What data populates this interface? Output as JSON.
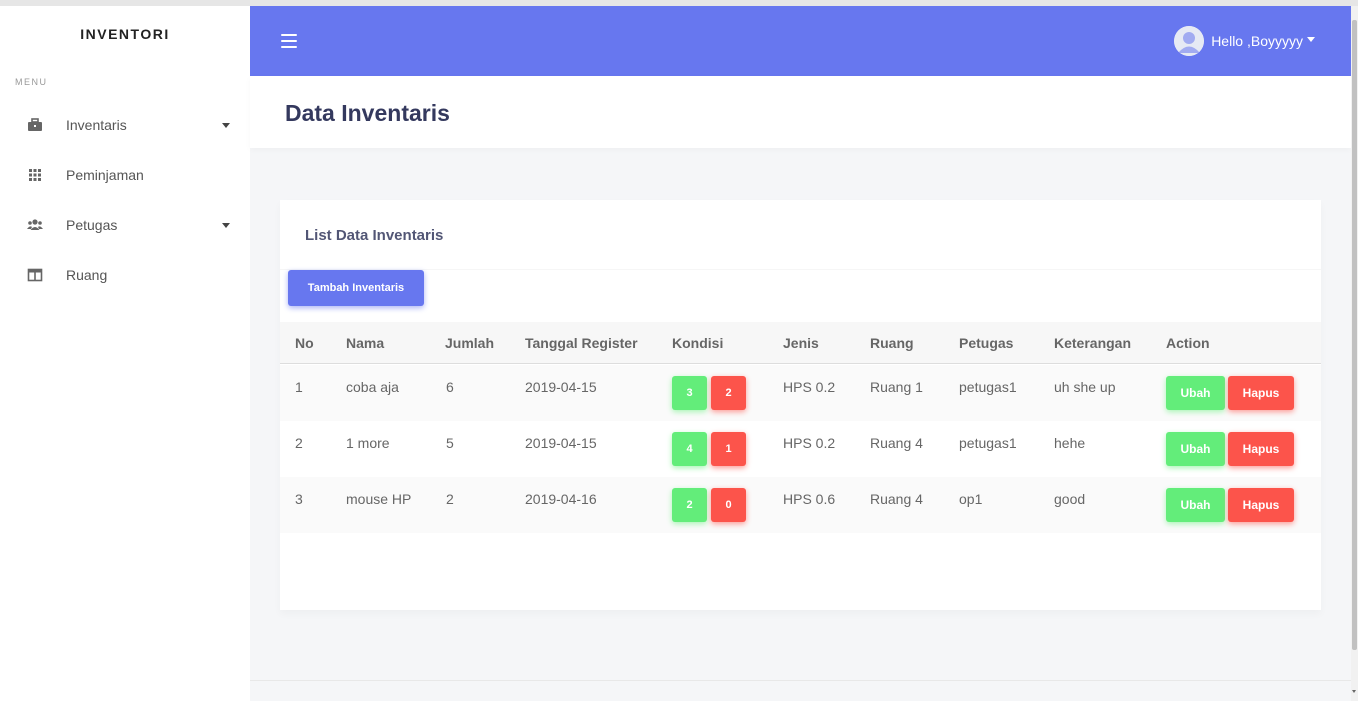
{
  "sidebar": {
    "brand": "INVENTORI",
    "menu_label": "MENU",
    "items": [
      {
        "label": "Inventaris",
        "icon": "briefcase-icon",
        "has_caret": true
      },
      {
        "label": "Peminjaman",
        "icon": "grid-icon",
        "has_caret": false
      },
      {
        "label": "Petugas",
        "icon": "users-icon",
        "has_caret": true
      },
      {
        "label": "Ruang",
        "icon": "columns-icon",
        "has_caret": false
      }
    ]
  },
  "topbar": {
    "menu_icon": "hamburger-icon",
    "user_greeting": "Hello ,Boyyyyy"
  },
  "page": {
    "title": "Data Inventaris"
  },
  "card": {
    "title": "List Data Inventaris",
    "add_button": "Tambah Inventaris",
    "columns": [
      "No",
      "Nama",
      "Jumlah",
      "Tanggal Register",
      "Kondisi",
      "Jenis",
      "Ruang",
      "Petugas",
      "Keterangan",
      "Action"
    ],
    "rows": [
      {
        "no": "1",
        "nama": "coba aja",
        "jumlah": "6",
        "tanggal": "2019-04-15",
        "kondisi_baik": "3",
        "kondisi_rusak": "2",
        "jenis": "HPS 0.2",
        "ruang": "Ruang 1",
        "petugas": "petugas1",
        "keterangan": "uh she up",
        "edit": "Ubah",
        "delete": "Hapus"
      },
      {
        "no": "2",
        "nama": "1 more",
        "jumlah": "5",
        "tanggal": "2019-04-15",
        "kondisi_baik": "4",
        "kondisi_rusak": "1",
        "jenis": "HPS 0.2",
        "ruang": "Ruang 4",
        "petugas": "petugas1",
        "keterangan": "hehe",
        "edit": "Ubah",
        "delete": "Hapus"
      },
      {
        "no": "3",
        "nama": "mouse HP",
        "jumlah": "2",
        "tanggal": "2019-04-16",
        "kondisi_baik": "2",
        "kondisi_rusak": "0",
        "jenis": "HPS 0.6",
        "ruang": "Ruang 4",
        "petugas": "op1",
        "keterangan": "good",
        "edit": "Ubah",
        "delete": "Hapus"
      }
    ]
  },
  "colors": {
    "primary": "#6777ef",
    "success": "#63ed7a",
    "danger": "#fc544b",
    "title": "#34395e"
  }
}
